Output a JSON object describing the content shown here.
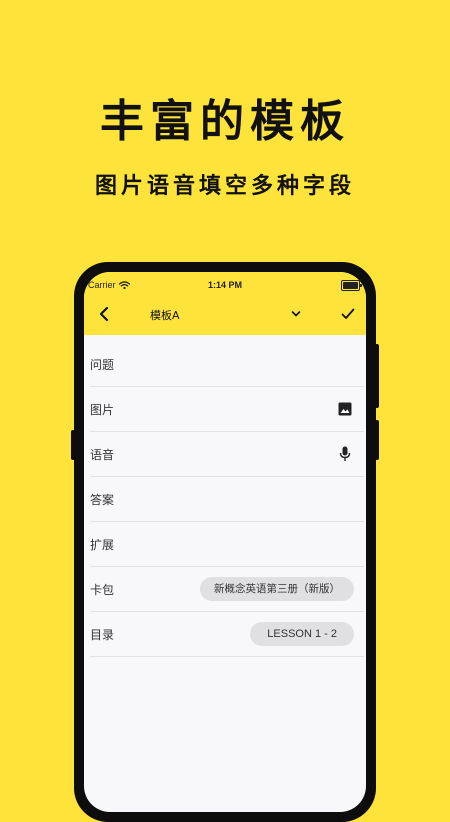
{
  "headline": "丰富的模板",
  "subheadline": "图片语音填空多种字段",
  "status_bar": {
    "carrier": "Carrier",
    "time": "1:14 PM"
  },
  "nav": {
    "back_icon": "chevron-left-icon",
    "title": "模板A",
    "dropdown_icon": "chevron-down-icon",
    "confirm_icon": "check-icon"
  },
  "form": {
    "rows": [
      {
        "label": "问题"
      },
      {
        "label": "图片",
        "icon": "image-icon"
      },
      {
        "label": "语音",
        "icon": "microphone-icon"
      },
      {
        "label": "答案"
      },
      {
        "label": "扩展"
      },
      {
        "label": "卡包",
        "value": "新概念英语第三册（新版）"
      },
      {
        "label": "目录",
        "value": "LESSON 1 - 2"
      }
    ]
  },
  "colors": {
    "background": "#FEE43A",
    "app_header": "#FEE43A",
    "screen_background": "#F8F7FA",
    "pill_background": "#E0E0E3",
    "divider": "#E2E1E6"
  }
}
